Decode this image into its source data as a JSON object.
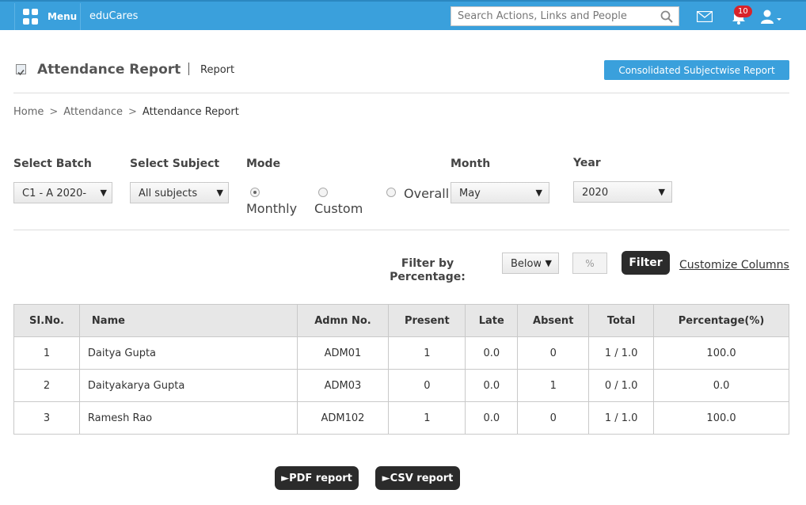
{
  "nav": {
    "menu_label": "Menu",
    "brand": "eduCares",
    "search_placeholder": "Search Actions, Links and People",
    "notification_count": "10",
    "accent_color": "#3aa0dc"
  },
  "header": {
    "title": "Attendance Report",
    "subtitle": "Report",
    "consolidated_button": "Consolidated Subjectwise Report"
  },
  "breadcrumb": {
    "items": [
      "Home",
      "Attendance",
      "Attendance Report"
    ],
    "separator": ">"
  },
  "filters": {
    "batch_label": "Select Batch",
    "batch_value": "C1 - A 2020-",
    "subject_label": "Select Subject",
    "subject_value": "All subjects",
    "mode_label": "Mode",
    "mode_options": [
      "Monthly",
      "Custom",
      "Overall"
    ],
    "mode_selected": "Monthly",
    "month_label": "Month",
    "month_value": "May",
    "year_label": "Year",
    "year_value": "2020"
  },
  "percentage_filter": {
    "label_line1": "Filter by",
    "label_line2": "Percentage:",
    "comparator_value": "Below",
    "percent_placeholder": "%",
    "filter_button": "Filter",
    "customize_link": "Customize Columns"
  },
  "table": {
    "columns": [
      "SI.No.",
      "Name",
      "Admn No.",
      "Present",
      "Late",
      "Absent",
      "Total",
      "Percentage(%)"
    ],
    "rows": [
      [
        "1",
        "Daitya Gupta",
        "ADM01",
        "1",
        "0.0",
        "0",
        "1 / 1.0",
        "100.0"
      ],
      [
        "2",
        "Daityakarya Gupta",
        "ADM03",
        "0",
        "0.0",
        "1",
        "0 / 1.0",
        "0.0"
      ],
      [
        "3",
        "Ramesh Rao",
        "ADM102",
        "1",
        "0.0",
        "0",
        "1 / 1.0",
        "100.0"
      ]
    ]
  },
  "export": {
    "pdf_button": "►PDF report",
    "csv_button": "►CSV report"
  }
}
